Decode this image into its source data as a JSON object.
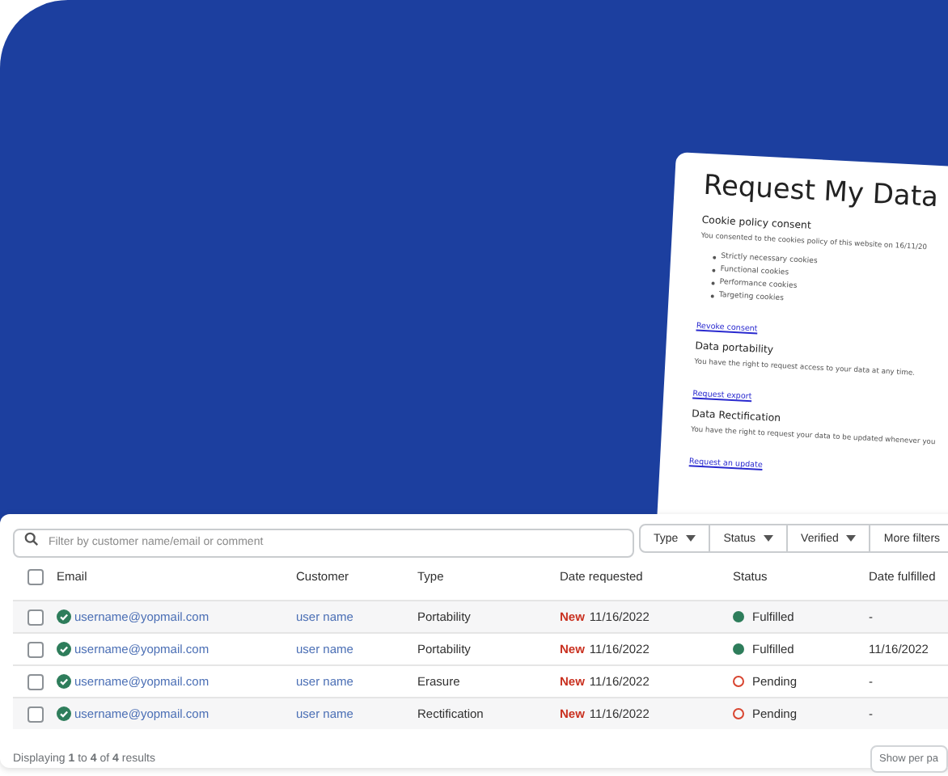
{
  "policy_card": {
    "title": "Request My Data",
    "sections": [
      {
        "heading": "Cookie policy consent",
        "text": "You consented to the cookies policy of this website on 16/11/20",
        "bullets": [
          "Strictly necessary cookies",
          "Functional cookies",
          "Performance cookies",
          "Targeting cookies"
        ],
        "link": "Revoke consent"
      },
      {
        "heading": "Data portability",
        "text": "You have the right to request access to your data at any time.",
        "link": "Request export"
      },
      {
        "heading": "Data Rectification",
        "text": "You have the right to request your data to be updated whenever you",
        "link": "Request an update"
      }
    ]
  },
  "search": {
    "placeholder": "Filter by customer name/email or comment"
  },
  "filters": [
    {
      "label": "Type",
      "dropdown": true
    },
    {
      "label": "Status",
      "dropdown": true
    },
    {
      "label": "Verified",
      "dropdown": true
    },
    {
      "label": "More filters",
      "dropdown": false
    }
  ],
  "table": {
    "select_all": {
      "checked": false
    },
    "columns": [
      "Email",
      "Customer",
      "Type",
      "Date requested",
      "Status",
      "Date fulfilled"
    ],
    "rows": [
      {
        "email": "username@yopmail.com",
        "customer": "user name",
        "type": "Portability",
        "badge": "New",
        "date": "11/16/2022",
        "status": "Fulfilled",
        "completed": true,
        "date_fulfilled": "-",
        "checked": false
      },
      {
        "email": "username@yopmail.com",
        "customer": "user name",
        "type": "Portability",
        "badge": "New",
        "date": "11/16/2022",
        "status": "Fulfilled",
        "completed": true,
        "date_fulfilled": "11/16/2022",
        "checked": false
      },
      {
        "email": "username@yopmail.com",
        "customer": "user name",
        "type": "Erasure",
        "badge": "New",
        "date": "11/16/2022",
        "status": "Pending",
        "completed": false,
        "date_fulfilled": "-",
        "checked": false
      },
      {
        "email": "username@yopmail.com",
        "customer": "user name",
        "type": "Rectification",
        "badge": "New",
        "date": "11/16/2022",
        "status": "Pending",
        "completed": false,
        "date_fulfilled": "-",
        "checked": false
      }
    ]
  },
  "footer": {
    "summary": "Displaying **1** to **4** of **4** results",
    "per_page": "Show per pa"
  }
}
